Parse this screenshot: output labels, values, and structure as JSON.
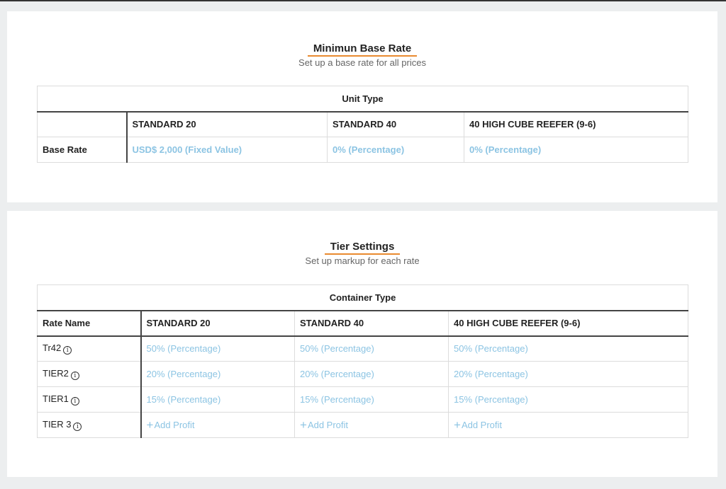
{
  "base_rate_section": {
    "title": "Minimun Base Rate",
    "subtitle": "Set up a base rate for all prices",
    "group_header": "Unit Type",
    "columns": [
      "STANDARD 20",
      "STANDARD 40",
      "40 HIGH CUBE REEFER (9-6)"
    ],
    "row_label": "Base Rate",
    "values": [
      "USD$ 2,000 (Fixed Value)",
      "0% (Percentage)",
      "0% (Percentage)"
    ]
  },
  "tier_section": {
    "title": "Tier Settings",
    "subtitle": "Set up markup for each rate",
    "group_header": "Container Type",
    "rate_name_header": "Rate Name",
    "columns": [
      "STANDARD 20",
      "STANDARD 40",
      "40 HIGH CUBE REEFER (9-6)"
    ],
    "rows": [
      {
        "name": "Tr42",
        "values": [
          "50% (Percentage)",
          "50% (Percentage)",
          "50% (Percentage)"
        ]
      },
      {
        "name": "TIER2",
        "values": [
          "20% (Percentage)",
          "20% (Percentage)",
          "20% (Percentage)"
        ]
      },
      {
        "name": "TIER1",
        "values": [
          "15% (Percentage)",
          "15% (Percentage)",
          "15% (Percentage)"
        ]
      },
      {
        "name": "TIER 3",
        "values": [
          "Add Profit",
          "Add Profit",
          "Add Profit"
        ]
      }
    ]
  },
  "icons": {
    "info": "info-icon",
    "add": "plus-icon"
  },
  "colors": {
    "accent_underline": "#e98a2f",
    "link": "#8cc4e3",
    "border_dark": "#444444"
  }
}
